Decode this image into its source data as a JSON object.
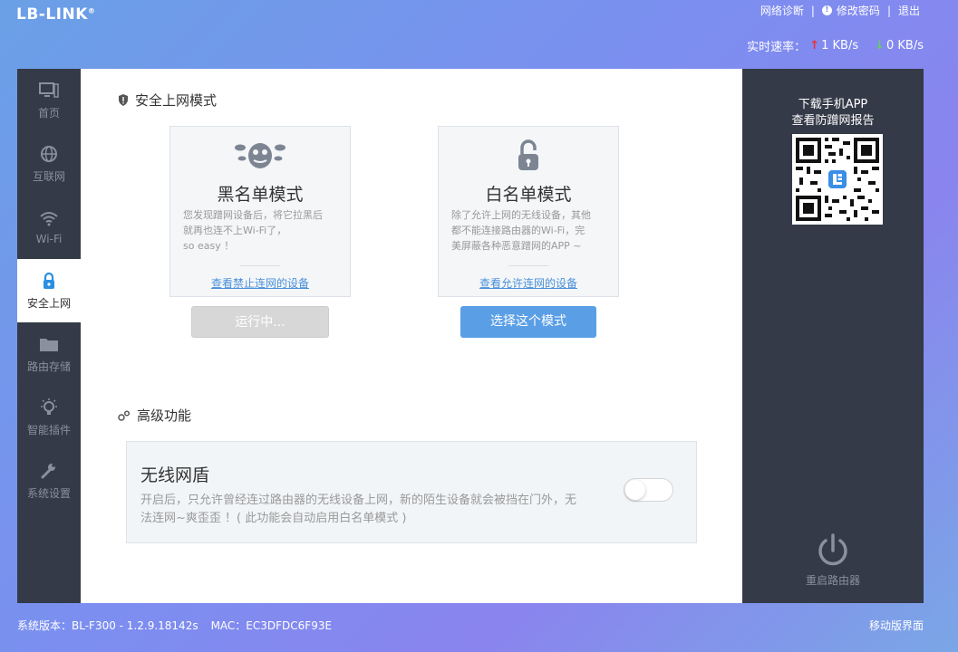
{
  "brand": {
    "logo": "LB-LINK",
    "trademark": "®"
  },
  "top_links": {
    "diagnose": "网络诊断",
    "sep1": "|",
    "change_password": "修改密码",
    "sep2": "|",
    "logout": "退出"
  },
  "speed": {
    "label": "实时速率：",
    "up": "1 KB/s",
    "down": "0 KB/s",
    "up_color": "#e33333",
    "down_color": "#66cc66"
  },
  "sidebar": {
    "items": [
      {
        "label": "首页",
        "icon": "monitor-icon",
        "active": false
      },
      {
        "label": "互联网",
        "icon": "globe-icon",
        "active": false
      },
      {
        "label": "Wi-Fi",
        "icon": "wifi-icon",
        "active": false
      },
      {
        "label": "安全上网",
        "icon": "lock-icon",
        "active": true
      },
      {
        "label": "路由存储",
        "icon": "folder-icon",
        "active": false
      },
      {
        "label": "智能插件",
        "icon": "bulb-icon",
        "active": false
      },
      {
        "label": "系统设置",
        "icon": "wrench-icon",
        "active": false
      }
    ]
  },
  "safe_mode": {
    "title": "安全上网模式",
    "blacklist": {
      "title": "黑名单模式",
      "desc_line1": "您发现蹭网设备后，将它拉黑后",
      "desc_line2": "就再也连不上Wi-Fi了，",
      "desc_line3": "so easy ！",
      "link": "查看禁止连网的设备",
      "button": "运行中..."
    },
    "whitelist": {
      "title": "白名单模式",
      "desc_line1": "除了允许上网的无线设备，其他",
      "desc_line2": "都不能连接路由器的Wi-Fi，完",
      "desc_line3": "美屏蔽各种恶意蹭网的APP ~",
      "link": "查看允许连网的设备",
      "button": "选择这个模式"
    }
  },
  "advanced": {
    "title": "高级功能",
    "wireless_shield": {
      "title": "无线网盾",
      "desc": "开启后，只允许曾经连过路由器的无线设备上网，新的陌生设备就会被挡在门外，无法连网~爽歪歪 ！( 此功能会自动启用白名单模式 )",
      "enabled": false
    }
  },
  "right_panel": {
    "app_line1": "下载手机APP",
    "app_line2": "查看防蹭网报告",
    "reboot": "重启路由器"
  },
  "footer": {
    "version": "系统版本：BL-F300 - 1.2.9.18142s",
    "mac": "MAC：EC3DFDC6F93E",
    "mobile": "移动版界面"
  },
  "colors": {
    "accent": "#5a9ee6",
    "sidebar_bg": "#343a47",
    "link": "#4a90d9"
  }
}
